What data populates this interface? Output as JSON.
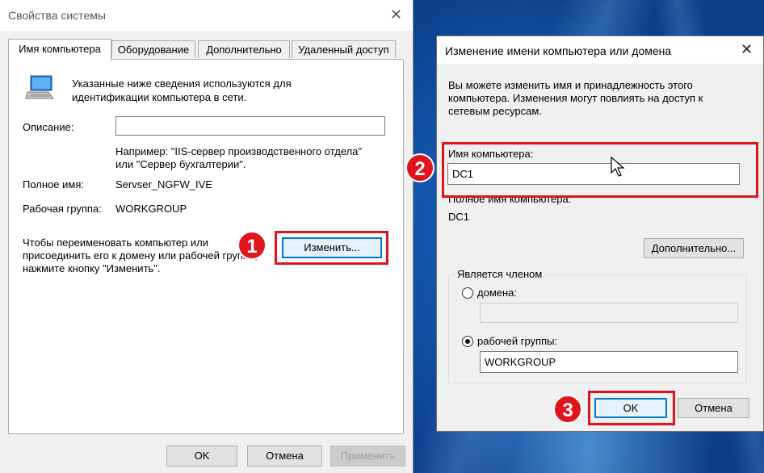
{
  "system_properties": {
    "title": "Свойства системы",
    "tabs": [
      {
        "label": "Имя компьютера",
        "active": true
      },
      {
        "label": "Оборудование"
      },
      {
        "label": "Дополнительно"
      },
      {
        "label": "Удаленный доступ"
      }
    ],
    "intro_line1": "Указанные ниже сведения используются для",
    "intro_line2": "идентификации компьютера в сети.",
    "description_label": "Описание:",
    "description_value": "",
    "example_line1": "Например: \"IIS-сервер производственного отдела\"",
    "example_line2": "или \"Сервер бухгалтерии\".",
    "full_name_label": "Полное имя:",
    "full_name_value": "Servser_NGFW_IVE",
    "workgroup_label": "Рабочая группа:",
    "workgroup_value": "WORKGROUP",
    "rename_text_line1": "Чтобы переименовать компьютер или",
    "rename_text_line2": "присоединить его к домену или рабочей группе,",
    "rename_text_line3": "нажмите кнопку \"Изменить\".",
    "change_button": "Изменить...",
    "ok_button": "OK",
    "cancel_button": "Отмена",
    "apply_button": "Применить"
  },
  "rename_dialog": {
    "title": "Изменение имени компьютера или домена",
    "intro_line1": "Вы можете изменить имя и принадлежность этого",
    "intro_line2": "компьютера. Изменения могут повлиять на доступ к",
    "intro_line3": "сетевым ресурсам.",
    "computer_name_label": "Имя компьютера:",
    "computer_name_value": "DC1",
    "full_name_label": "Полное имя компьютера:",
    "full_name_value": "DC1",
    "more_button": "Дополнительно...",
    "member_of_label": "Является членом",
    "domain_label": "домена:",
    "domain_value": "",
    "workgroup_label": "рабочей группы:",
    "workgroup_value": "WORKGROUP",
    "ok_button": "OK",
    "cancel_button": "Отмена"
  },
  "callouts": [
    "1",
    "2",
    "3"
  ],
  "colors": {
    "highlight": "#e1141c",
    "accent": "#0078d7"
  }
}
